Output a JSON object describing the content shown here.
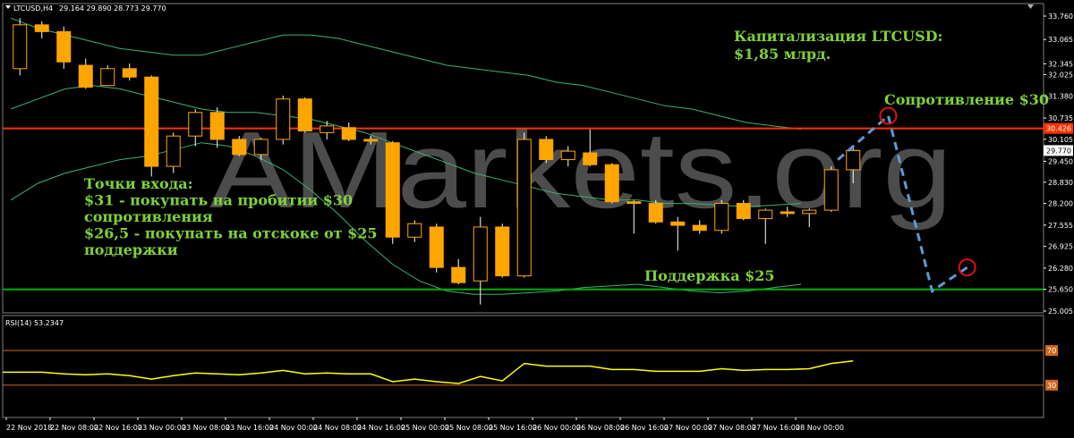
{
  "window": {
    "symbol_header": "LTCUSD,H4",
    "ohlc_header": "29.164 29.890 28.773 29.770",
    "rsi_header": "RSI(14) 53.2347",
    "watermark": "AMarkets.org"
  },
  "colors": {
    "background": "#000000",
    "bull_body": "#000000",
    "bear_body": "#ffa500",
    "candle_outline": "#ffa500",
    "wick": "#ffffff",
    "resistance_line": "#ff3300",
    "support_line": "#00b000",
    "bands": "#3cb371",
    "rsi_line": "#ffff00",
    "rsi_levels": "#d2691e",
    "forecast": "#5b9bd5",
    "annotation_text": "#7fd23a"
  },
  "annotations": {
    "capitalization_line1": "Капитализация LTCUSD:",
    "capitalization_line2": "$1,85 млрд.",
    "resistance": "Сопротивление $30",
    "support": "Поддержка $25",
    "entry_line1": "Точки входа:",
    "entry_line2": "$31 - покупать на пробитии $30",
    "entry_line3": "сопротивления",
    "entry_line4": "$26,5 - покупать на отскоке от $25",
    "entry_line5": "поддержки"
  },
  "chart_data": {
    "type": "candlestick",
    "symbol": "LTCUSD",
    "timeframe": "H4",
    "price_axis_ticks": [
      "33.760",
      "33.065",
      "32.345",
      "32.025",
      "31.380",
      "30.735",
      "30.105",
      "29.450",
      "28.830",
      "28.200",
      "27.555",
      "26.925",
      "26.280",
      "25.650",
      "25.005"
    ],
    "current_price": "29.770",
    "resistance_price": "30.426",
    "support_price": 25.65,
    "ylim": [
      25.005,
      33.76
    ],
    "time_labels": [
      "22 Nov 2018",
      "22 Nov 08:00",
      "22 Nov 16:00",
      "23 Nov 00:00",
      "23 Nov 08:00",
      "23 Nov 16:00",
      "24 Nov 00:00",
      "24 Nov 08:00",
      "24 Nov 16:00",
      "25 Nov 00:00",
      "25 Nov 08:00",
      "25 Nov 16:00",
      "26 Nov 00:00",
      "26 Nov 08:00",
      "26 Nov 16:00",
      "27 Nov 00:00",
      "27 Nov 08:00",
      "27 Nov 16:00",
      "28 Nov 00:00"
    ],
    "candles": [
      {
        "o": 32.2,
        "h": 33.7,
        "l": 32.0,
        "c": 33.5
      },
      {
        "o": 33.5,
        "h": 33.6,
        "l": 33.1,
        "c": 33.3
      },
      {
        "o": 33.3,
        "h": 33.45,
        "l": 32.2,
        "c": 32.4
      },
      {
        "o": 32.3,
        "h": 32.5,
        "l": 31.6,
        "c": 31.65
      },
      {
        "o": 31.7,
        "h": 32.3,
        "l": 31.7,
        "c": 32.2
      },
      {
        "o": 32.2,
        "h": 32.35,
        "l": 31.85,
        "c": 31.95
      },
      {
        "o": 31.95,
        "h": 32.0,
        "l": 29.0,
        "c": 29.3
      },
      {
        "o": 29.3,
        "h": 30.3,
        "l": 29.1,
        "c": 30.2
      },
      {
        "o": 30.2,
        "h": 31.0,
        "l": 29.9,
        "c": 30.9
      },
      {
        "o": 30.9,
        "h": 31.05,
        "l": 29.85,
        "c": 30.1
      },
      {
        "o": 30.1,
        "h": 30.2,
        "l": 29.6,
        "c": 29.65
      },
      {
        "o": 29.65,
        "h": 30.15,
        "l": 29.5,
        "c": 30.1
      },
      {
        "o": 30.1,
        "h": 31.4,
        "l": 29.95,
        "c": 31.3
      },
      {
        "o": 31.3,
        "h": 31.35,
        "l": 30.3,
        "c": 30.35
      },
      {
        "o": 30.3,
        "h": 30.65,
        "l": 30.1,
        "c": 30.5
      },
      {
        "o": 30.45,
        "h": 30.6,
        "l": 30.05,
        "c": 30.1
      },
      {
        "o": 30.1,
        "h": 30.2,
        "l": 29.95,
        "c": 30.05
      },
      {
        "o": 30.0,
        "h": 30.05,
        "l": 27.0,
        "c": 27.2
      },
      {
        "o": 27.2,
        "h": 27.7,
        "l": 27.05,
        "c": 27.6
      },
      {
        "o": 27.5,
        "h": 27.6,
        "l": 26.15,
        "c": 26.3
      },
      {
        "o": 26.3,
        "h": 26.55,
        "l": 25.8,
        "c": 25.85
      },
      {
        "o": 25.9,
        "h": 27.8,
        "l": 25.2,
        "c": 27.5
      },
      {
        "o": 27.5,
        "h": 27.6,
        "l": 26.0,
        "c": 26.05
      },
      {
        "o": 26.05,
        "h": 30.3,
        "l": 26.0,
        "c": 30.1
      },
      {
        "o": 30.1,
        "h": 30.2,
        "l": 29.4,
        "c": 29.5
      },
      {
        "o": 29.5,
        "h": 29.9,
        "l": 29.3,
        "c": 29.75
      },
      {
        "o": 29.7,
        "h": 30.4,
        "l": 29.3,
        "c": 29.35
      },
      {
        "o": 29.35,
        "h": 29.4,
        "l": 28.2,
        "c": 28.25
      },
      {
        "o": 28.25,
        "h": 28.3,
        "l": 27.3,
        "c": 28.2
      },
      {
        "o": 28.2,
        "h": 28.3,
        "l": 27.6,
        "c": 27.65
      },
      {
        "o": 27.65,
        "h": 27.8,
        "l": 26.8,
        "c": 27.55
      },
      {
        "o": 27.55,
        "h": 27.7,
        "l": 27.3,
        "c": 27.4
      },
      {
        "o": 27.4,
        "h": 28.3,
        "l": 27.3,
        "c": 28.2
      },
      {
        "o": 28.2,
        "h": 28.3,
        "l": 27.7,
        "c": 27.75
      },
      {
        "o": 27.75,
        "h": 28.05,
        "l": 27.0,
        "c": 28.0
      },
      {
        "o": 27.95,
        "h": 28.1,
        "l": 27.8,
        "c": 27.9
      },
      {
        "o": 27.9,
        "h": 28.05,
        "l": 27.5,
        "c": 28.0
      },
      {
        "o": 28.0,
        "h": 29.3,
        "l": 27.95,
        "c": 29.2
      },
      {
        "o": 29.2,
        "h": 29.9,
        "l": 28.8,
        "c": 29.77
      }
    ],
    "bands": {
      "upper": [
        33.7,
        33.4,
        33.2,
        33.0,
        32.8,
        32.7,
        32.6,
        32.6,
        32.8,
        33.0,
        33.2,
        33.2,
        33.1,
        32.9,
        32.7,
        32.5,
        32.3,
        32.2,
        32.1,
        32.0,
        31.8,
        31.7,
        31.5,
        31.3,
        31.1,
        31.0,
        30.8,
        30.6,
        30.5,
        30.4
      ],
      "middle": [
        31.0,
        31.3,
        31.6,
        31.7,
        31.6,
        31.4,
        31.2,
        31.0,
        30.9,
        30.9,
        30.8,
        30.7,
        30.5,
        30.3,
        30.0,
        29.7,
        29.4,
        29.1,
        28.9,
        28.7,
        28.5,
        28.4,
        28.3,
        28.3,
        28.2,
        28.2,
        28.15,
        28.1,
        28.15,
        28.2
      ],
      "lower": [
        28.3,
        28.8,
        29.1,
        29.3,
        29.5,
        29.6,
        29.8,
        30.0,
        29.9,
        29.6,
        29.2,
        28.6,
        27.9,
        27.1,
        26.4,
        25.9,
        25.6,
        25.5,
        25.5,
        25.55,
        25.6,
        25.7,
        25.75,
        25.8,
        25.7,
        25.6,
        25.55,
        25.6,
        25.7,
        25.8
      ]
    },
    "forecast_path": [
      {
        "bar": 37.3,
        "price": 29.5
      },
      {
        "bar": 39.6,
        "price": 30.8
      },
      {
        "bar": 41.6,
        "price": 25.6
      },
      {
        "bar": 43.2,
        "price": 26.3
      }
    ],
    "rsi": {
      "period": 14,
      "value": "53.2347",
      "levels": [
        "70",
        "30"
      ],
      "ylim": [
        0,
        100
      ],
      "values": [
        45,
        45,
        43,
        42,
        43,
        41,
        37,
        41,
        44,
        43,
        42,
        44,
        47,
        43,
        44,
        43,
        43,
        34,
        37,
        34,
        32,
        40,
        35,
        55,
        52,
        52,
        52,
        48,
        48,
        46,
        46,
        46,
        49,
        47,
        48,
        48,
        49,
        55,
        58
      ]
    }
  }
}
